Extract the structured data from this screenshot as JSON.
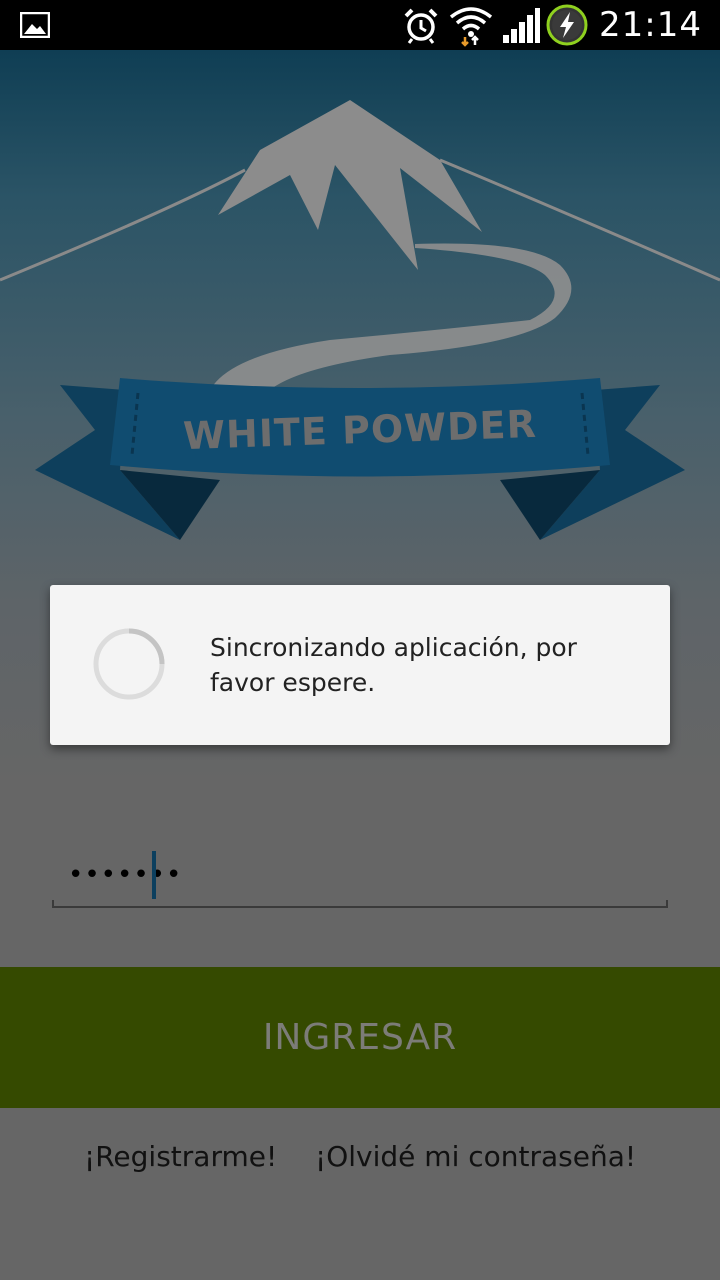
{
  "status_bar": {
    "time": "21:14",
    "icons": [
      "gallery-notification-icon",
      "alarm-icon",
      "wifi-icon",
      "signal-icon",
      "battery-charging-icon"
    ]
  },
  "brand": {
    "logo_text": "WHITE POWDER",
    "colors": {
      "ribbon": "#0f4b6d",
      "ribbon_dark": "#0a3149",
      "mountain": "#8a8a8a",
      "text": "#6c6c6c"
    }
  },
  "dialog": {
    "message": "Sincronizando aplicación, por favor espere."
  },
  "login": {
    "password_value": "•••••••",
    "submit_label": "INGRESAR",
    "button_color": "#354a00"
  },
  "links": {
    "register": "¡Registrarme!",
    "forgot_password": "¡Olvidé mi contraseña!"
  }
}
